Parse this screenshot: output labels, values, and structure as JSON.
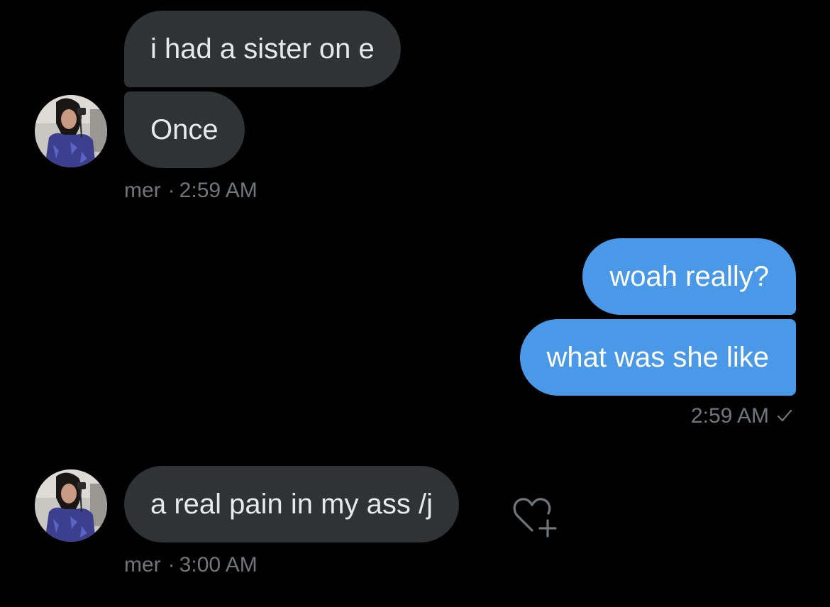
{
  "conversation": {
    "group1": {
      "messages": [
        "i had a sister on e",
        "Once"
      ],
      "sender": "mer",
      "separator": "·",
      "time": "2:59 AM"
    },
    "group2": {
      "messages": [
        "woah really?",
        "what was she like"
      ],
      "time": "2:59 AM"
    },
    "group3": {
      "messages": [
        "a real pain in my ass /j"
      ],
      "sender": "mer",
      "separator": "·",
      "time": "3:00 AM"
    }
  },
  "icons": {
    "read_receipt": "check-icon",
    "add_reaction": "heart-plus-icon",
    "avatar": "avatar"
  },
  "colors": {
    "background": "#000000",
    "incoming_bubble": "#2f3336",
    "outgoing_bubble": "#4a99e9",
    "meta_text": "#71767b"
  }
}
